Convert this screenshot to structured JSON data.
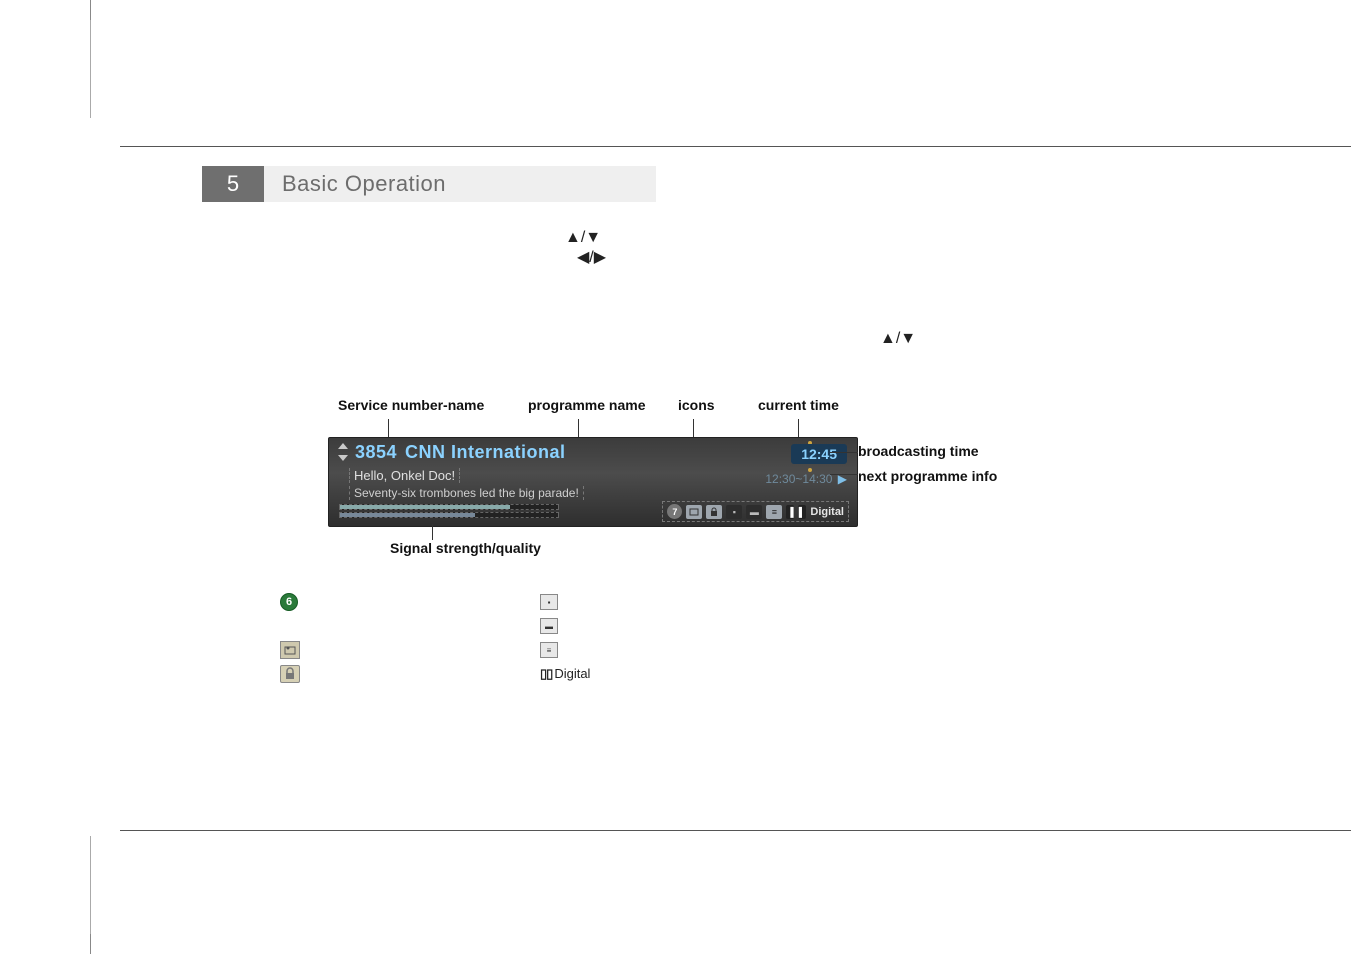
{
  "chapter": {
    "number": "5",
    "title": "Basic Operation"
  },
  "arrows": {
    "updown": "▲/▼",
    "leftright": "◀/▶"
  },
  "osd_labels": {
    "service": "Service number-name",
    "programme": "programme name",
    "icons": "icons",
    "current_time": "current time",
    "broadcasting_time": "broadcasting time",
    "next_prog": "next programme info",
    "signal": "Signal strength/quality"
  },
  "osd": {
    "service_number": "3854",
    "service_name": "CNN International",
    "current_time": "12:45",
    "broadcast_window": "12:30~14:30",
    "programme": "Hello, Onkel Doc!",
    "next_short": "Seventy-six trombones led the big parade!",
    "icon_group_text": "Digital",
    "round_icon": "7"
  },
  "legend": {
    "dolby": "Digital"
  }
}
